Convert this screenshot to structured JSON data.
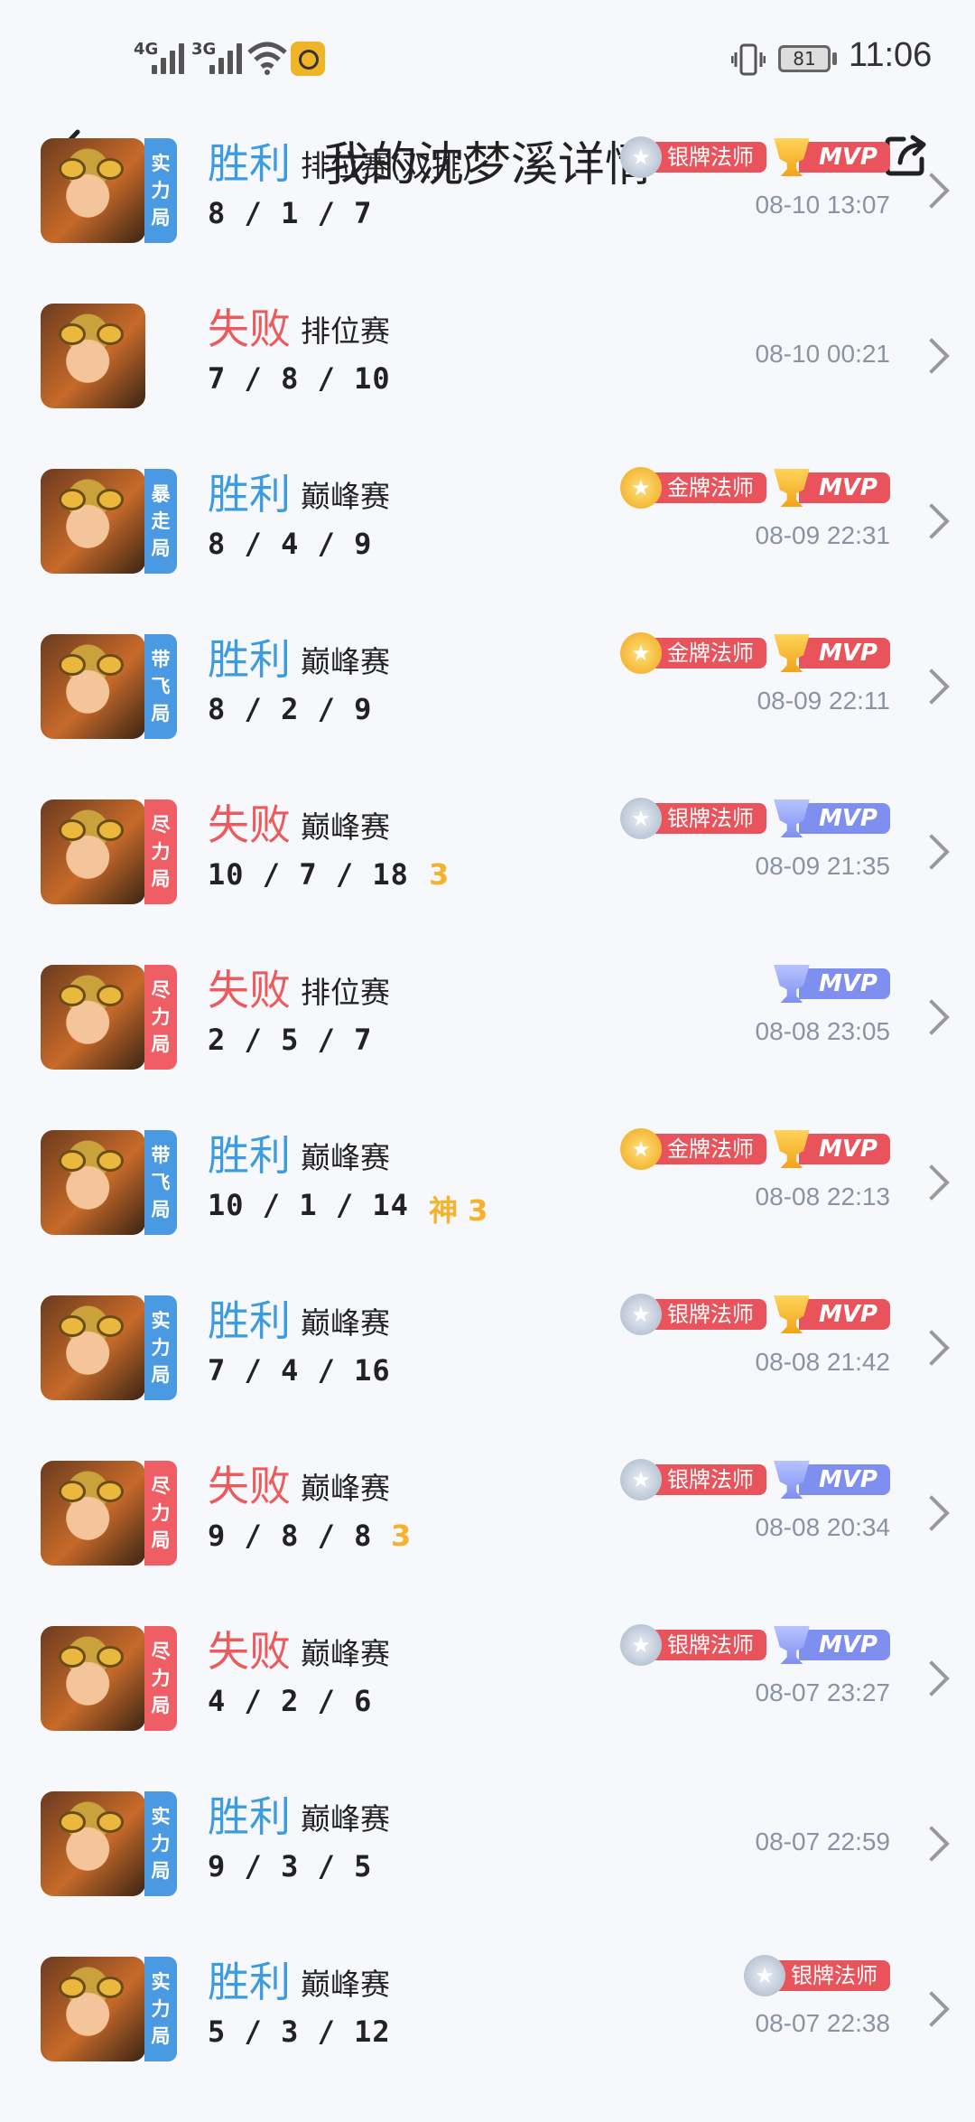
{
  "status_bar": {
    "sig1": "4G",
    "sig2": "3G",
    "battery": "81",
    "time": "11:06"
  },
  "nav": {
    "title": "我的沈梦溪详情"
  },
  "matches": [
    {
      "result": "胜利",
      "win": true,
      "mode": "排位赛(双排)",
      "kda": "8 / 1 / 7",
      "tag": [
        "实",
        "力",
        "局"
      ],
      "tag_color": "blue",
      "extra": "",
      "time": "08-10 13:07",
      "medal": "silver",
      "medal_label": "银牌法师",
      "mvp": "gold"
    },
    {
      "result": "失败",
      "win": false,
      "mode": "排位赛",
      "kda": "7 / 8 / 10",
      "tag": [],
      "tag_color": "",
      "extra": "",
      "time": "08-10 00:21",
      "medal": "",
      "medal_label": "",
      "mvp": ""
    },
    {
      "result": "胜利",
      "win": true,
      "mode": "巅峰赛",
      "kda": "8 / 4 / 9",
      "tag": [
        "暴",
        "走",
        "局"
      ],
      "tag_color": "blue",
      "extra": "",
      "time": "08-09 22:31",
      "medal": "gold",
      "medal_label": "金牌法师",
      "mvp": "gold"
    },
    {
      "result": "胜利",
      "win": true,
      "mode": "巅峰赛",
      "kda": "8 / 2 / 9",
      "tag": [
        "带",
        "飞",
        "局"
      ],
      "tag_color": "blue",
      "extra": "",
      "time": "08-09 22:11",
      "medal": "gold",
      "medal_label": "金牌法师",
      "mvp": "gold"
    },
    {
      "result": "失败",
      "win": false,
      "mode": "巅峰赛",
      "kda": "10 / 7 / 18",
      "tag": [
        "尽",
        "力",
        "局"
      ],
      "tag_color": "red",
      "extra": "3",
      "time": "08-09 21:35",
      "medal": "silver",
      "medal_label": "银牌法师",
      "mvp": "blue"
    },
    {
      "result": "失败",
      "win": false,
      "mode": "排位赛",
      "kda": "2 / 5 / 7",
      "tag": [
        "尽",
        "力",
        "局"
      ],
      "tag_color": "red",
      "extra": "",
      "time": "08-08 23:05",
      "medal": "",
      "medal_label": "",
      "mvp": "blue"
    },
    {
      "result": "胜利",
      "win": true,
      "mode": "巅峰赛",
      "kda": "10 / 1 / 14",
      "tag": [
        "带",
        "飞",
        "局"
      ],
      "tag_color": "blue",
      "extra": "神 3",
      "time": "08-08 22:13",
      "medal": "gold",
      "medal_label": "金牌法师",
      "mvp": "gold"
    },
    {
      "result": "胜利",
      "win": true,
      "mode": "巅峰赛",
      "kda": "7 / 4 / 16",
      "tag": [
        "实",
        "力",
        "局"
      ],
      "tag_color": "blue",
      "extra": "",
      "time": "08-08 21:42",
      "medal": "silver",
      "medal_label": "银牌法师",
      "mvp": "gold"
    },
    {
      "result": "失败",
      "win": false,
      "mode": "巅峰赛",
      "kda": "9 / 8 / 8",
      "tag": [
        "尽",
        "力",
        "局"
      ],
      "tag_color": "red",
      "extra": "3",
      "time": "08-08 20:34",
      "medal": "silver",
      "medal_label": "银牌法师",
      "mvp": "blue"
    },
    {
      "result": "失败",
      "win": false,
      "mode": "巅峰赛",
      "kda": "4 / 2 / 6",
      "tag": [
        "尽",
        "力",
        "局"
      ],
      "tag_color": "red",
      "extra": "",
      "time": "08-07 23:27",
      "medal": "silver",
      "medal_label": "银牌法师",
      "mvp": "blue"
    },
    {
      "result": "胜利",
      "win": true,
      "mode": "巅峰赛",
      "kda": "9 / 3 / 5",
      "tag": [
        "实",
        "力",
        "局"
      ],
      "tag_color": "blue",
      "extra": "",
      "time": "08-07 22:59",
      "medal": "",
      "medal_label": "",
      "mvp": ""
    },
    {
      "result": "胜利",
      "win": true,
      "mode": "巅峰赛",
      "kda": "5 / 3 / 12",
      "tag": [
        "实",
        "力",
        "局"
      ],
      "tag_color": "blue",
      "extra": "",
      "time": "08-07 22:38",
      "medal": "silver",
      "medal_label": "银牌法师",
      "mvp": ""
    }
  ],
  "mvp_text": "MVP",
  "icons": {
    "back": "back-arrow-icon",
    "share": "share-icon",
    "chevron": "chevron-right-icon"
  }
}
